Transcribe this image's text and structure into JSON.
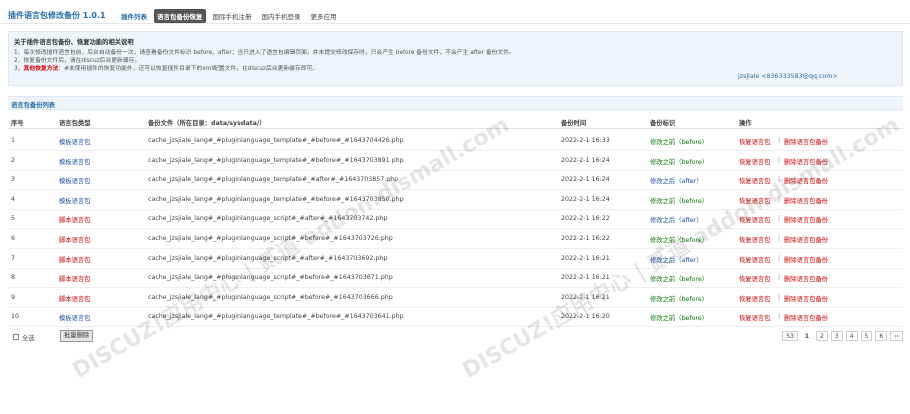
{
  "header": {
    "title": "插件语言包修改备份 1.0.1",
    "tabs": [
      "插件列表",
      "语言包备份恢复",
      "国际手机注册",
      "国内手机登录",
      "更多应用"
    ]
  },
  "notice": {
    "heading": "关于插件语言包备份、恢复功能的相关说明",
    "lines": [
      "1、每次修改插件语言包前，后台自动备份一次，请查看备份文件标识 before、after；当只进入了语言包编辑页面，并未提交修改保存时，只会产生 before 备份文件，不会产生 after 备份文件。",
      "2、恢复备份文件后，请在discuz后台更新缓存。",
      "其他恢复方法",
      "：#未使用插件的恢复功能外，还可以恢复插件目录下的xml配置文件，在discuz后台更新缓存即可。"
    ],
    "line3_prefix": "3、",
    "author": "jzsjiale <836333583@qq.com>"
  },
  "section_title": "语言包备份列表",
  "table": {
    "headers": [
      "序号",
      "语言包类型",
      "备份文件（所在目录：data/sysdata/）",
      "备份时间",
      "备份标识",
      "操作"
    ],
    "rows": [
      {
        "idx": "1",
        "type": "模板语言包",
        "type_kind": "template",
        "file": "cache_jzsjiale_lang#_#pluginlanguage_template#_#before#_#1643704426.php",
        "time": "2022-2-1 16:33",
        "flag": "修改之前（before）",
        "flag_kind": "before"
      },
      {
        "idx": "2",
        "type": "模板语言包",
        "type_kind": "template",
        "file": "cache_jzsjiale_lang#_#pluginlanguage_template#_#before#_#1643703891.php",
        "time": "2022-2-1 16:24",
        "flag": "修改之前（before）",
        "flag_kind": "before"
      },
      {
        "idx": "3",
        "type": "模板语言包",
        "type_kind": "template",
        "file": "cache_jzsjiale_lang#_#pluginlanguage_template#_#after#_#1643703857.php",
        "time": "2022-2-1 16:24",
        "flag": "修改之后（after）",
        "flag_kind": "after"
      },
      {
        "idx": "4",
        "type": "模板语言包",
        "type_kind": "template",
        "file": "cache_jzsjiale_lang#_#pluginlanguage_template#_#before#_#1643703850.php",
        "time": "2022-2-1 16:24",
        "flag": "修改之前（before）",
        "flag_kind": "before"
      },
      {
        "idx": "5",
        "type": "脚本语言包",
        "type_kind": "script",
        "file": "cache_jzsjiale_lang#_#pluginlanguage_script#_#after#_#1643703742.php",
        "time": "2022-2-1 16:22",
        "flag": "修改之后（after）",
        "flag_kind": "after"
      },
      {
        "idx": "6",
        "type": "脚本语言包",
        "type_kind": "script",
        "file": "cache_jzsjiale_lang#_#pluginlanguage_script#_#before#_#1643703726.php",
        "time": "2022-2-1 16:22",
        "flag": "修改之前（before）",
        "flag_kind": "before"
      },
      {
        "idx": "7",
        "type": "脚本语言包",
        "type_kind": "script",
        "file": "cache_jzsjiale_lang#_#pluginlanguage_script#_#after#_#1643703692.php",
        "time": "2022-2-1 16:21",
        "flag": "修改之后（after）",
        "flag_kind": "after"
      },
      {
        "idx": "8",
        "type": "脚本语言包",
        "type_kind": "script",
        "file": "cache_jzsjiale_lang#_#pluginlanguage_script#_#before#_#1643703671.php",
        "time": "2022-2-1 16:21",
        "flag": "修改之前（before）",
        "flag_kind": "before"
      },
      {
        "idx": "9",
        "type": "脚本语言包",
        "type_kind": "script",
        "file": "cache_jzsjiale_lang#_#pluginlanguage_script#_#before#_#1643703666.php",
        "time": "2022-2-1 16:21",
        "flag": "修改之前（before）",
        "flag_kind": "before"
      },
      {
        "idx": "10",
        "type": "模板语言包",
        "type_kind": "template",
        "file": "cache_jzsjiale_lang#_#pluginlanguage_template#_#before#_#1643703641.php",
        "time": "2022-2-1 16:20",
        "flag": "修改之前（before）",
        "flag_kind": "before"
      }
    ],
    "actions": {
      "restore": "恢复语言包",
      "separator": "|",
      "delete": "删除语言包备份"
    }
  },
  "footer": {
    "select_all": "全选",
    "batch_delete": "批量删除",
    "pager": [
      "53",
      "1",
      "2",
      "3",
      "4",
      "5",
      "6",
      "››"
    ],
    "current_page": "1"
  },
  "watermark": "DISCUZ!应用中心 | 贰道 addon.dismall.com",
  "colors": {
    "link_blue": "#2a6fa8",
    "danger_red": "#cc0000",
    "ok_green": "#0a7a0a",
    "panel_bg": "#eef4fa"
  }
}
